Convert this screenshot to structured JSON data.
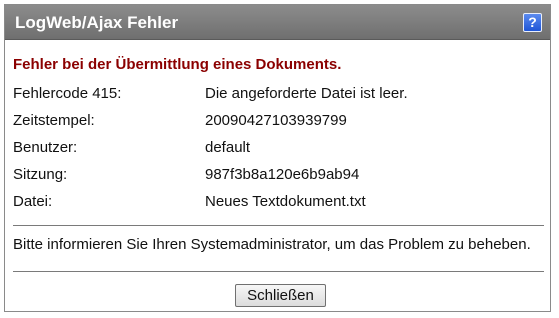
{
  "dialog": {
    "title": "LogWeb/Ajax Fehler",
    "help_label": "?",
    "error_heading": "Fehler bei der Übermittlung eines Dokuments.",
    "details": [
      {
        "label": "Fehlercode 415:",
        "value": "Die angeforderte Datei ist leer."
      },
      {
        "label": "Zeitstempel:",
        "value": "20090427103939799"
      },
      {
        "label": "Benutzer:",
        "value": "default"
      },
      {
        "label": "Sitzung:",
        "value": "987f3b8a120e6b9ab94"
      },
      {
        "label": "Datei:",
        "value": "Neues Textdokument.txt"
      }
    ],
    "message": "Bitte informieren Sie Ihren Systemadministrator, um das Problem zu beheben.",
    "close_label": "Schließen"
  },
  "colors": {
    "titlebar": "#7d7d7d",
    "error_heading": "#8b0000",
    "help_button": "#2a5fdc"
  },
  "icons": {
    "help": "help-icon"
  }
}
